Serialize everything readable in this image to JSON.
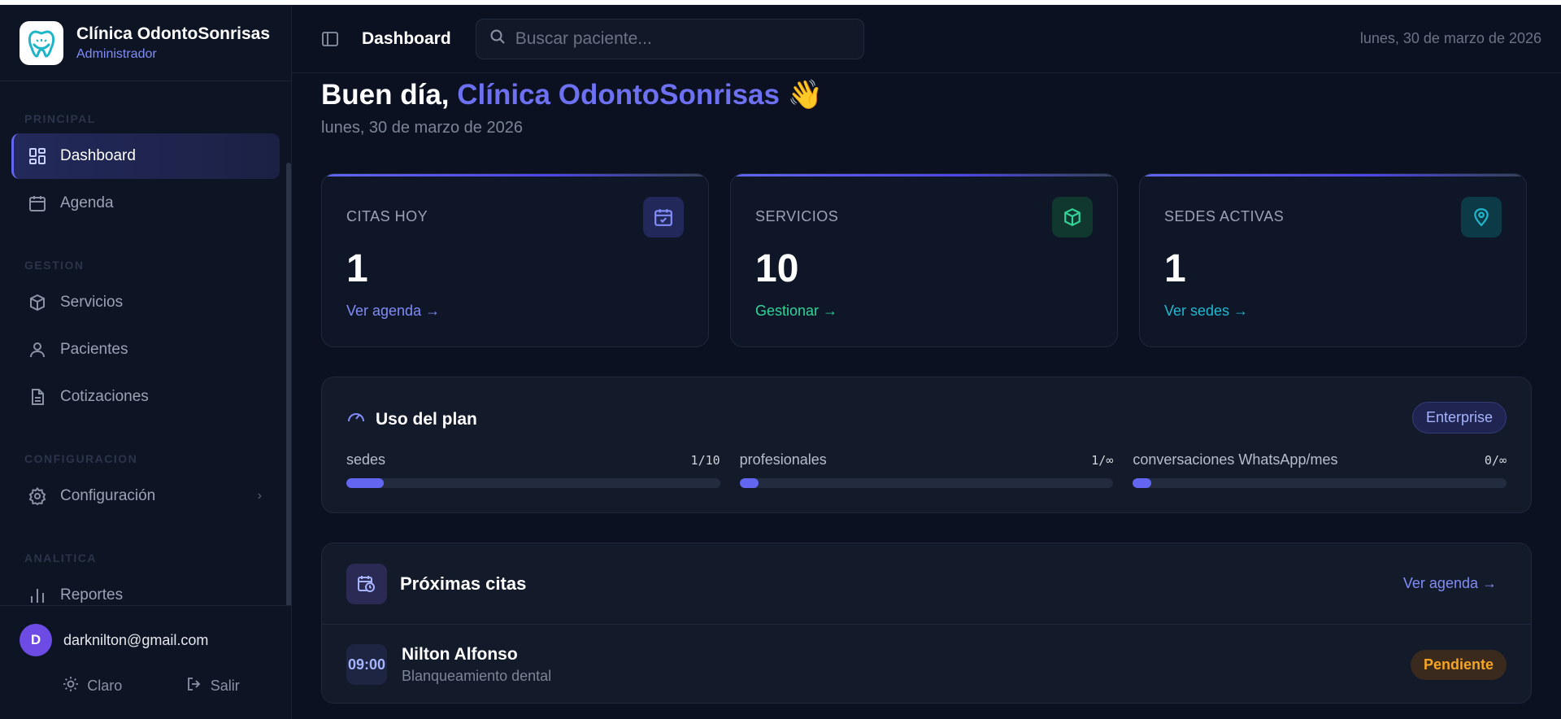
{
  "brand": {
    "name": "Clínica OdontoSonrisas",
    "role": "Administrador"
  },
  "sidebar": {
    "sections": [
      {
        "label": "PRINCIPAL",
        "items": [
          {
            "label": "Dashboard",
            "icon": "dashboard-grid-icon",
            "active": true
          },
          {
            "label": "Agenda",
            "icon": "calendar-icon"
          }
        ]
      },
      {
        "label": "GESTION",
        "items": [
          {
            "label": "Servicios",
            "icon": "box-icon"
          },
          {
            "label": "Pacientes",
            "icon": "user-icon"
          },
          {
            "label": "Cotizaciones",
            "icon": "document-icon"
          }
        ]
      },
      {
        "label": "CONFIGURACION",
        "items": [
          {
            "label": "Configuración",
            "icon": "gear-icon"
          }
        ]
      },
      {
        "label": "ANALITICA",
        "items": [
          {
            "label": "Reportes",
            "icon": "bar-chart-icon"
          }
        ]
      }
    ]
  },
  "user": {
    "initial": "D",
    "email": "darknilton@gmail.com"
  },
  "footer": {
    "theme_label": "Claro",
    "logout_label": "Salir"
  },
  "topbar": {
    "title": "Dashboard",
    "search_placeholder": "Buscar paciente...",
    "date": "lunes, 30 de marzo de 2026"
  },
  "greeting": {
    "prefix": "Buen día, ",
    "name": "Clínica OdontoSonrisas",
    "emoji": "👋",
    "date": "lunes, 30 de marzo de 2026"
  },
  "stats": [
    {
      "label": "CITAS HOY",
      "value": "1",
      "link": "Ver agenda →",
      "color": "#818cf8",
      "icon_bg": "#22285a"
    },
    {
      "label": "SERVICIOS",
      "value": "10",
      "link": "Gestionar →",
      "color": "#34d399",
      "icon_bg": "#10382f"
    },
    {
      "label": "SEDES ACTIVAS",
      "value": "1",
      "link": "Ver sedes →",
      "color": "#22b8cf",
      "icon_bg": "#0c3a46"
    }
  ],
  "plan": {
    "title": "Uso del plan",
    "badge": "Enterprise",
    "meters": [
      {
        "name": "sedes",
        "count": "1/10",
        "fill": 0.1
      },
      {
        "name": "profesionales",
        "count": "1/∞",
        "fill": 0.05
      },
      {
        "name": "conversaciones WhatsApp/mes",
        "count": "0/∞",
        "fill": 0.05
      }
    ]
  },
  "appointments": {
    "title": "Próximas citas",
    "link": "Ver agenda →",
    "rows": [
      {
        "time": "09:00",
        "patient": "Nilton Alfonso",
        "service": "Blanqueamiento dental",
        "status": "Pendiente"
      }
    ]
  },
  "colors": {
    "accent": "#6366f1",
    "background": "#0b1120",
    "pending": "#f5a524"
  }
}
